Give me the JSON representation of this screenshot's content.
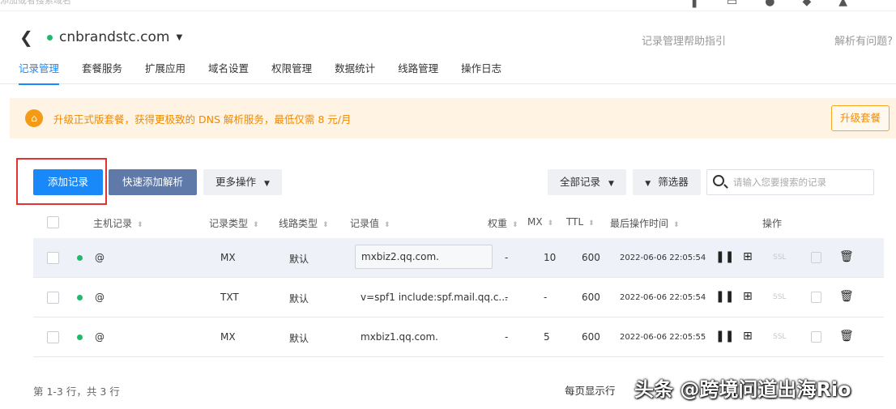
{
  "topbar": {
    "search_placeholder_ghost": "添加或者搜索域名"
  },
  "header": {
    "back_icon": "chevron-left-icon",
    "domain": "cnbrandstc.com",
    "status_color": "#1fba6b",
    "help_link": "记录管理帮助指引",
    "issue_link": "解析有问题?"
  },
  "tabs": [
    "记录管理",
    "套餐服务",
    "扩展应用",
    "域名设置",
    "权限管理",
    "数据统计",
    "线路管理",
    "操作日志"
  ],
  "banner": {
    "text": "升级正式版套餐，获得更极致的 DNS 解析服务，最低仅需 8 元/月",
    "button": "升级套餐",
    "accent": "#f08a00"
  },
  "toolbar": {
    "add": "添加记录",
    "quick_add": "快速添加解析",
    "more": "更多操作",
    "all_records": "全部记录",
    "filter": "筛选器",
    "search_placeholder": "请输入您要搜索的记录",
    "primary_color": "#1989fa"
  },
  "table": {
    "headers": {
      "host": "主机记录",
      "type": "记录类型",
      "line": "线路类型",
      "value": "记录值",
      "weight": "权重",
      "mx": "MX",
      "ttl": "TTL",
      "time": "最后操作时间",
      "actions": "操作"
    },
    "rows": [
      {
        "host": "@",
        "type": "MX",
        "line": "默认",
        "value": "mxbiz2.qq.com.",
        "weight": "-",
        "mx": "10",
        "ttl": "600",
        "time": "2022-06-06 22:05:54",
        "ssl": "SSL"
      },
      {
        "host": "@",
        "type": "TXT",
        "line": "默认",
        "value": "v=spf1 include:spf.mail.qq.c...",
        "weight": "-",
        "mx": "-",
        "ttl": "600",
        "time": "2022-06-06 22:05:54",
        "ssl": "SSL"
      },
      {
        "host": "@",
        "type": "MX",
        "line": "默认",
        "value": "mxbiz1.qq.com.",
        "weight": "-",
        "mx": "5",
        "ttl": "600",
        "time": "2022-06-06 22:05:55",
        "ssl": "SSL"
      }
    ]
  },
  "footer": {
    "summary": "第 1-3 行，共 3 行",
    "per_page": "每页显示行"
  },
  "watermark": "头条 @跨境问道出海Rio"
}
